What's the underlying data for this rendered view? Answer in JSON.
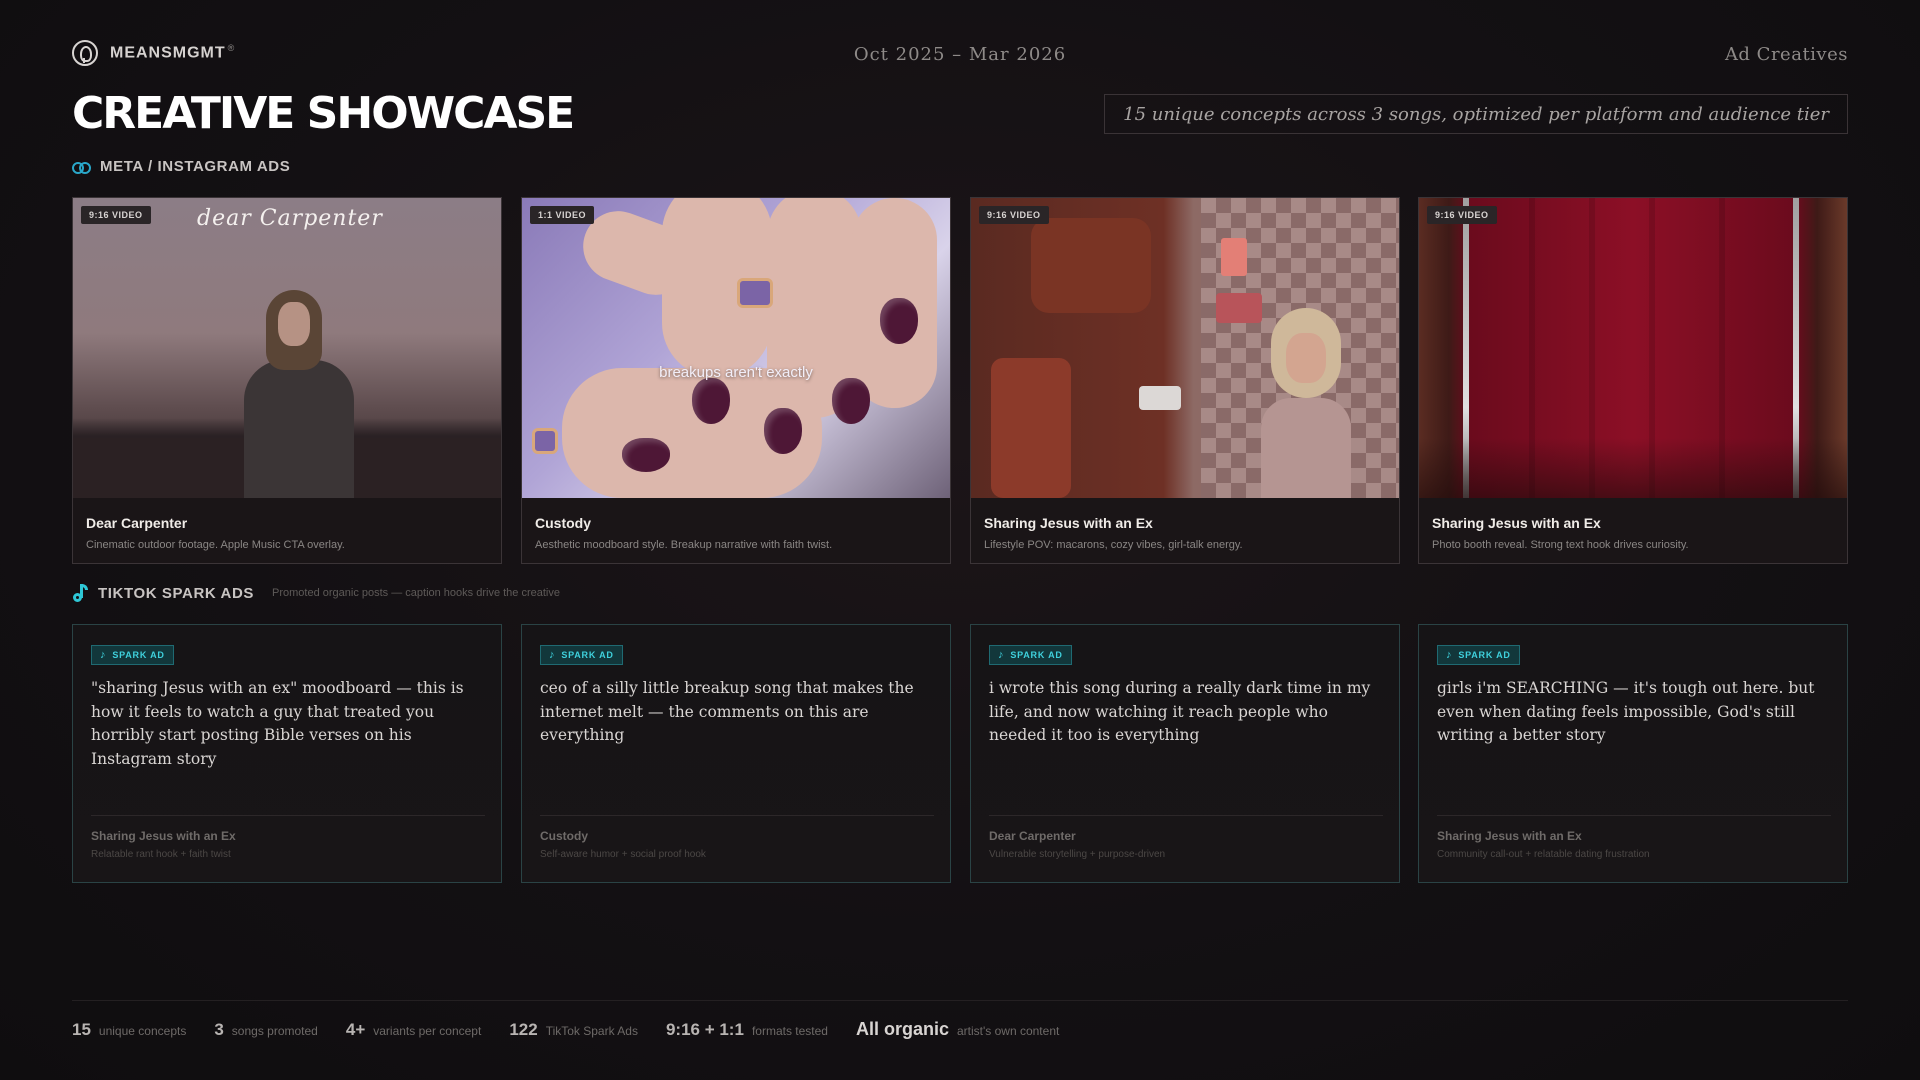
{
  "brand": {
    "name": "MEANSMGMT",
    "mark": "®",
    "logo_icon": "face-profile-icon"
  },
  "header": {
    "date_range": "Oct 2025 – Mar 2026",
    "section": "Ad Creatives",
    "title": "CREATIVE SHOWCASE",
    "tagline": "15 unique concepts across 3 songs, optimized per platform and audience tier"
  },
  "meta_section": {
    "icon": "meta-infinity-icon",
    "label": "META / INSTAGRAM ADS",
    "cards": [
      {
        "format": "9:16 VIDEO",
        "title": "Dear Carpenter",
        "desc": "Cinematic outdoor footage. Apple Music CTA overlay.",
        "overlay_text": "dear Carpenter"
      },
      {
        "format": "1:1 VIDEO",
        "title": "Custody",
        "desc": "Aesthetic moodboard style. Breakup narrative with faith twist.",
        "overlay_text": "breakups aren't exactly"
      },
      {
        "format": "9:16 VIDEO",
        "title": "Sharing Jesus with an Ex",
        "desc": "Lifestyle POV: macarons, cozy vibes, girl-talk energy."
      },
      {
        "format": "9:16 VIDEO",
        "title": "Sharing Jesus with an Ex",
        "desc": "Photo booth reveal. Strong text hook drives curiosity."
      }
    ]
  },
  "tiktok_section": {
    "icon": "tiktok-icon",
    "label": "TIKTOK SPARK ADS",
    "sub": "Promoted organic posts — caption hooks drive the creative",
    "cards": [
      {
        "badge": "SPARK AD",
        "quote": "\"sharing Jesus with an ex\" moodboard — this is how it feels to watch a guy that treated you horribly start posting Bible verses on his Instagram story",
        "song": "Sharing Jesus with an Ex",
        "note": "Relatable rant hook + faith twist"
      },
      {
        "badge": "SPARK AD",
        "quote": "ceo of a silly little breakup song that makes the internet melt — the comments on this are everything",
        "song": "Custody",
        "note": "Self-aware humor + social proof hook"
      },
      {
        "badge": "SPARK AD",
        "quote": "i wrote this song during a really dark time in my life, and now watching it reach people who needed it too is everything",
        "song": "Dear Carpenter",
        "note": "Vulnerable storytelling + purpose-driven"
      },
      {
        "badge": "SPARK AD",
        "quote": "girls i'm SEARCHING — it's tough out here. but even when dating feels impossible, God's still writing a better story",
        "song": "Sharing Jesus with an Ex",
        "note": "Community call-out + relatable dating frustration"
      }
    ]
  },
  "footer": {
    "stats": [
      {
        "value": "15",
        "label": "unique concepts"
      },
      {
        "value": "3",
        "label": "songs promoted"
      },
      {
        "value": "4+",
        "label": "variants per concept"
      },
      {
        "value": "122",
        "label": "TikTok Spark Ads"
      },
      {
        "value": "9:16 + 1:1",
        "label": "formats tested"
      },
      {
        "value": "All organic",
        "label": "artist's own content"
      }
    ]
  },
  "colors": {
    "accent_teal": "#3fd0dc",
    "meta_blue": "#2aa7c9",
    "background": "#131013"
  }
}
